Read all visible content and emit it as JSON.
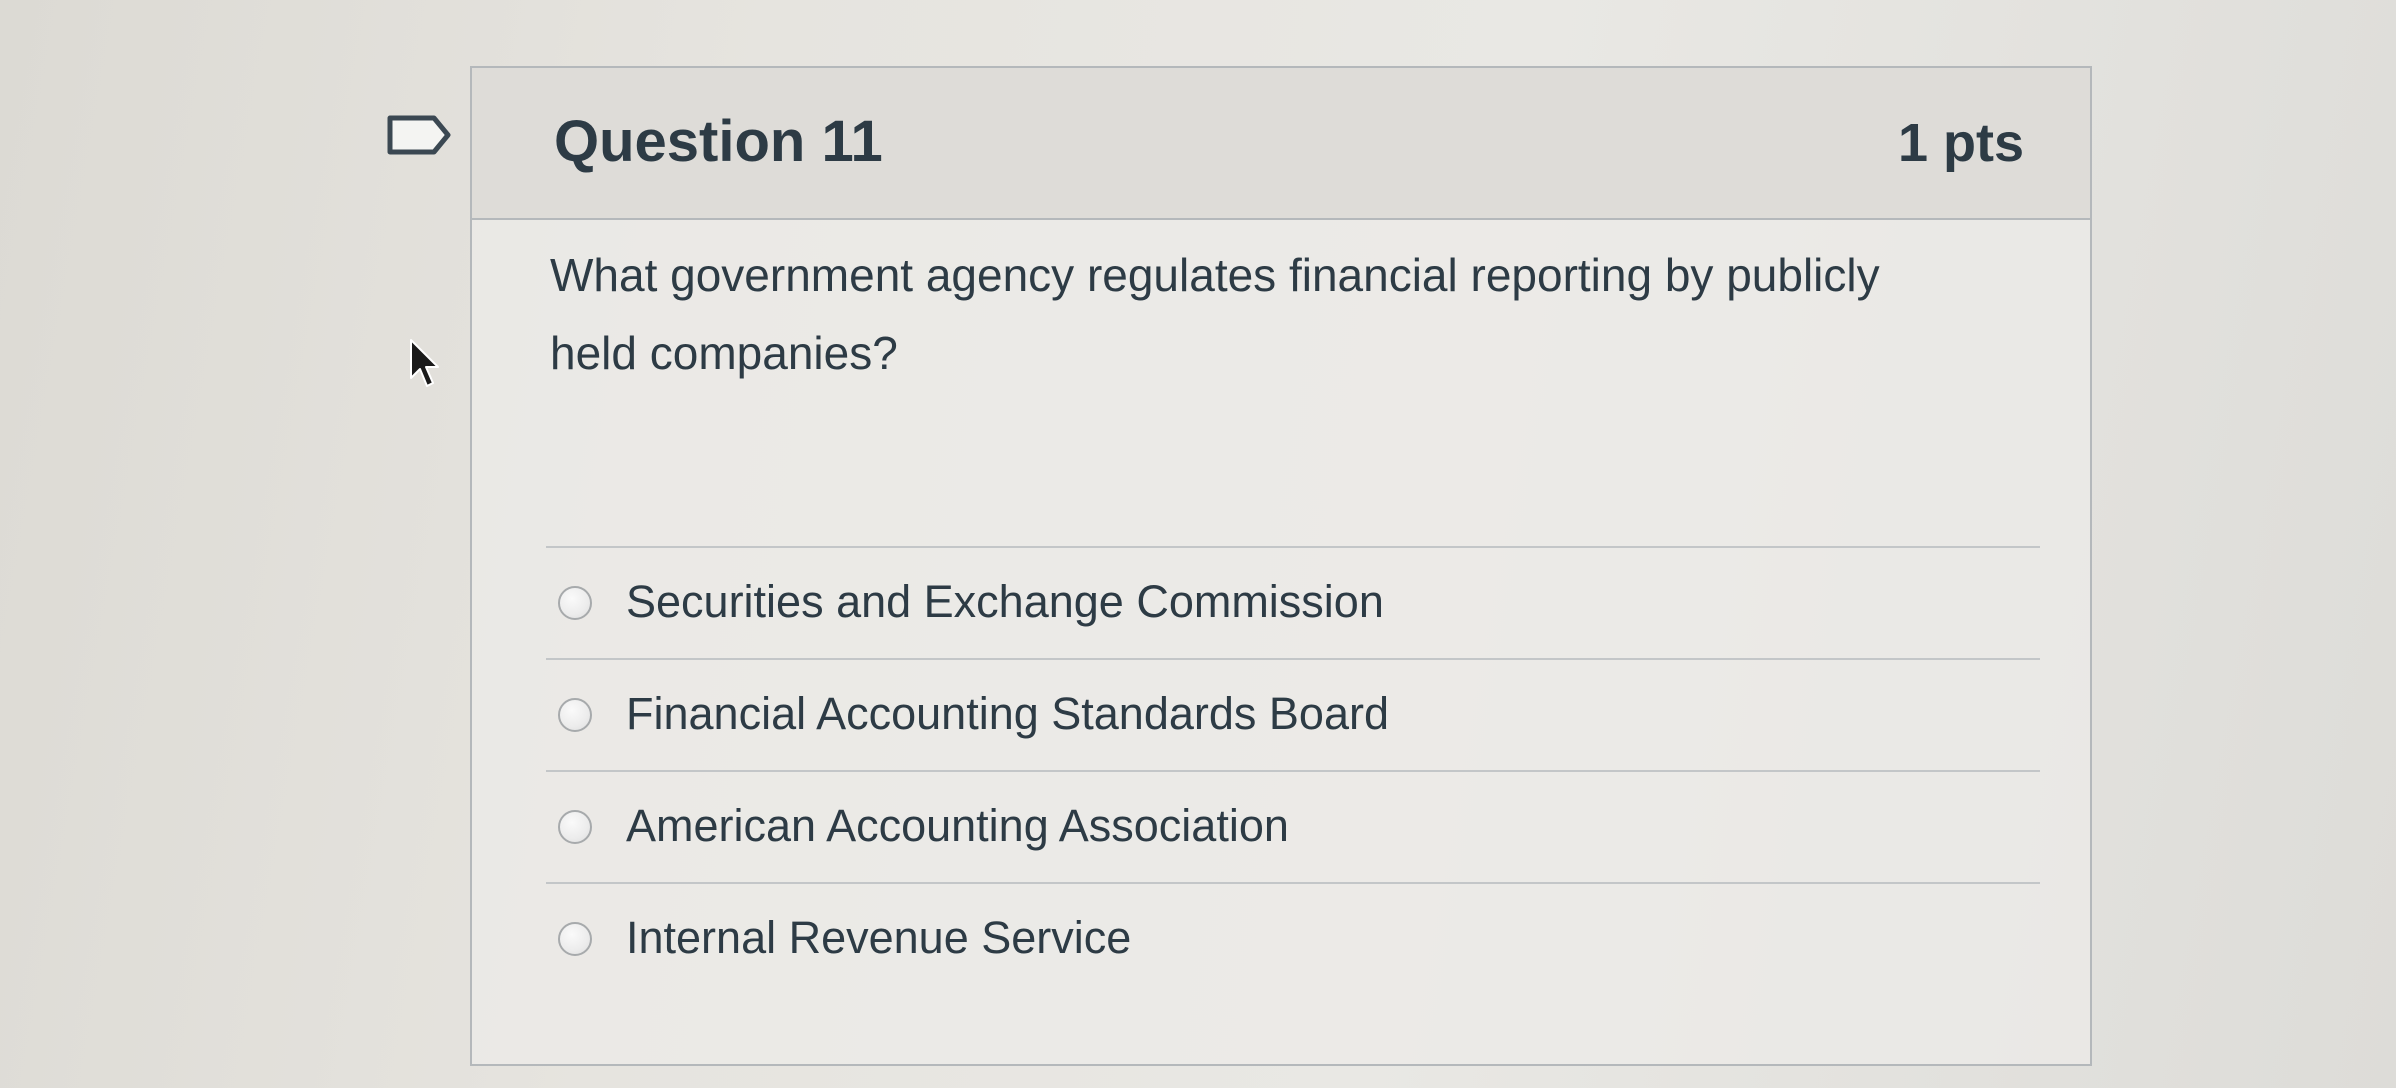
{
  "question": {
    "title": "Question 11",
    "points": "1 pts",
    "text": "What government agency regulates financial reporting by publicly held companies?",
    "answers": [
      {
        "label": "Securities and Exchange Commission",
        "selected": false
      },
      {
        "label": "Financial Accounting Standards Board",
        "selected": false
      },
      {
        "label": "American Accounting Association",
        "selected": false
      },
      {
        "label": "Internal Revenue Service",
        "selected": false
      }
    ]
  },
  "icons": {
    "flag": "bookmark-flag-icon",
    "cursor": "mouse-cursor-icon",
    "radio": "radio-button-icon"
  },
  "colors": {
    "text": "#2d3b45",
    "border": "#b4b8bb",
    "header_bg": "#dedcd8"
  }
}
